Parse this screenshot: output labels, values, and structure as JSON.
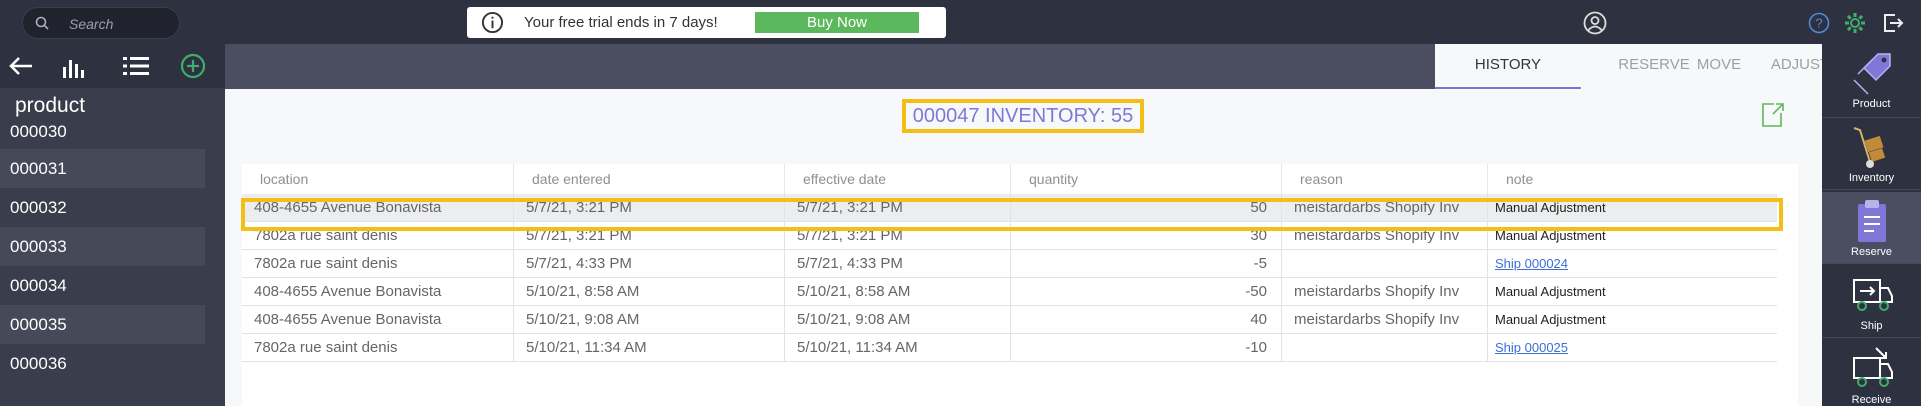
{
  "topbar": {
    "search_placeholder": "Search",
    "trial_message": "Your free trial ends in 7 days!",
    "buy_label": "Buy Now"
  },
  "sidebar": {
    "heading": "product",
    "items": [
      "000030",
      "000031",
      "000032",
      "000033",
      "000034",
      "000035",
      "000036"
    ]
  },
  "tabs": [
    "HISTORY",
    "RESERVE",
    "ADJUST",
    "MOVE"
  ],
  "active_tab": "HISTORY",
  "inventory_title": "000047 INVENTORY: 55",
  "table": {
    "columns": [
      "location",
      "date entered",
      "effective date",
      "quantity",
      "reason",
      "note"
    ],
    "rows": [
      {
        "location": "408-4655 Avenue Bonavista",
        "date_entered": "5/7/21, 3:21 PM",
        "effective_date": "5/7/21, 3:21 PM",
        "quantity": "50",
        "reason": "meistardarbs Shopify Inv",
        "note": "Manual Adjustment",
        "note_link": false
      },
      {
        "location": "7802a rue saint denis",
        "date_entered": "5/7/21, 3:21 PM",
        "effective_date": "5/7/21, 3:21 PM",
        "quantity": "30",
        "reason": "meistardarbs Shopify Inv",
        "note": "Manual Adjustment",
        "note_link": false
      },
      {
        "location": "7802a rue saint denis",
        "date_entered": "5/7/21, 4:33 PM",
        "effective_date": "5/7/21, 4:33 PM",
        "quantity": "-5",
        "reason": "",
        "note": "Ship 000024",
        "note_link": true
      },
      {
        "location": "408-4655 Avenue Bonavista",
        "date_entered": "5/10/21, 8:58 AM",
        "effective_date": "5/10/21, 8:58 AM",
        "quantity": "-50",
        "reason": "meistardarbs Shopify Inv",
        "note": "Manual Adjustment",
        "note_link": false
      },
      {
        "location": "408-4655 Avenue Bonavista",
        "date_entered": "5/10/21, 9:08 AM",
        "effective_date": "5/10/21, 9:08 AM",
        "quantity": "40",
        "reason": "meistardarbs Shopify Inv",
        "note": "Manual Adjustment",
        "note_link": false
      },
      {
        "location": "7802a rue saint denis",
        "date_entered": "5/10/21, 11:34 AM",
        "effective_date": "5/10/21, 11:34 AM",
        "quantity": "-10",
        "reason": "",
        "note": "Ship 000025",
        "note_link": true
      }
    ]
  },
  "right_nav": [
    "Product",
    "Inventory",
    "Reserve",
    "Ship",
    "Receive"
  ],
  "colors": {
    "accent": "#7f78d9",
    "highlight": "#f4be19",
    "buy": "#5cb85c",
    "gear": "#3fae6c",
    "link": "#3b6fd6"
  }
}
